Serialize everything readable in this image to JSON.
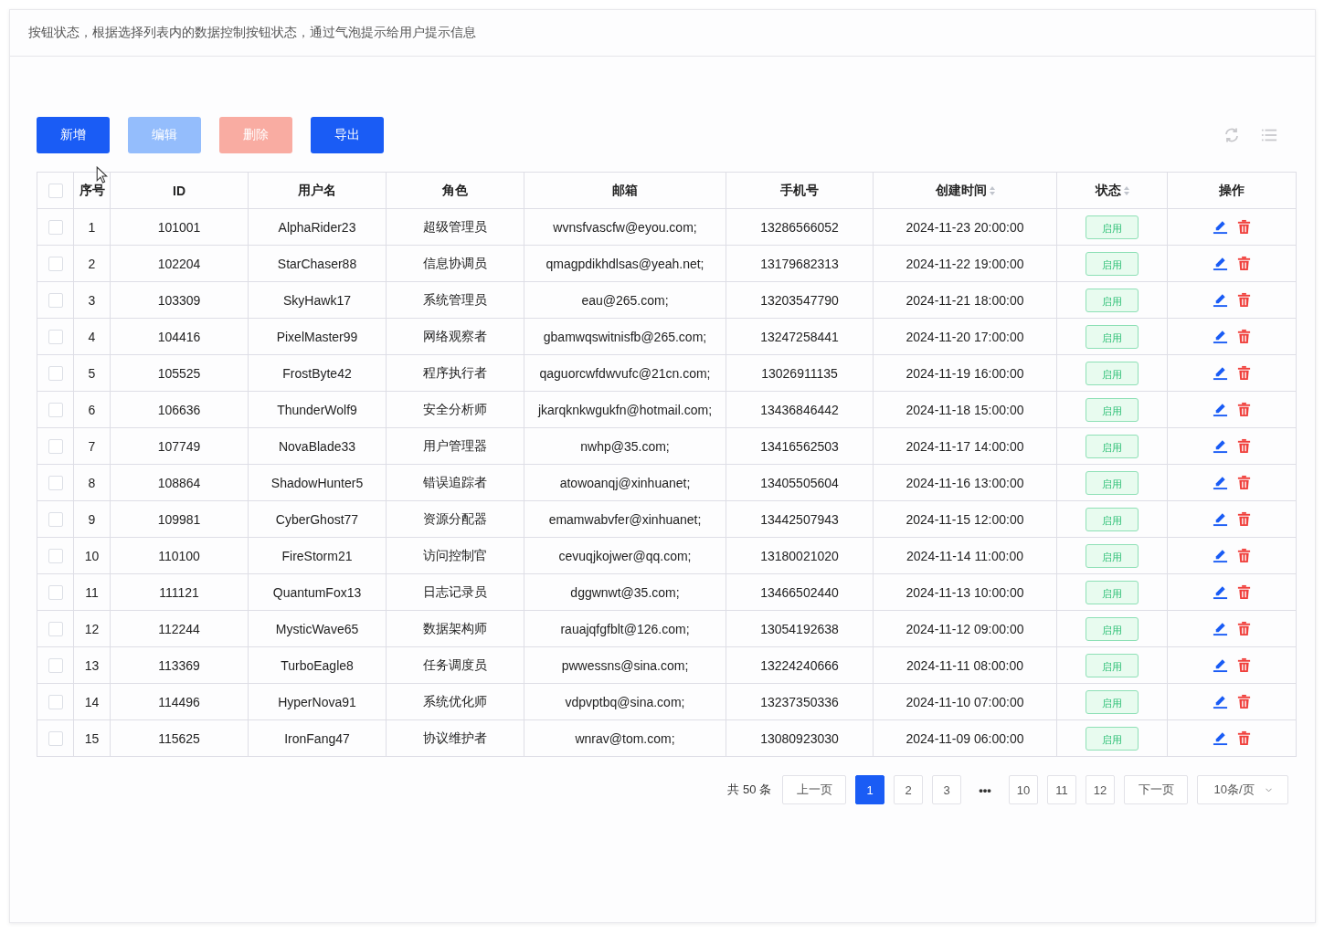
{
  "header": {
    "title": "按钮状态，根据选择列表内的数据控制按钮状态，通过气泡提示给用户提示信息"
  },
  "toolbar": {
    "buttons": [
      {
        "label": "新增",
        "kind": "primary",
        "disabled": false
      },
      {
        "label": "编辑",
        "kind": "primary",
        "disabled": true
      },
      {
        "label": "删除",
        "kind": "danger",
        "disabled": true
      },
      {
        "label": "导出",
        "kind": "primary",
        "disabled": false
      }
    ]
  },
  "table": {
    "columns": [
      {
        "label": "序号",
        "sortable": false
      },
      {
        "label": "ID",
        "sortable": false
      },
      {
        "label": "用户名",
        "sortable": false
      },
      {
        "label": "角色",
        "sortable": false
      },
      {
        "label": "邮箱",
        "sortable": false
      },
      {
        "label": "手机号",
        "sortable": false
      },
      {
        "label": "创建时间",
        "sortable": true
      },
      {
        "label": "状态",
        "sortable": true
      },
      {
        "label": "操作",
        "sortable": false
      }
    ],
    "all_checked": false,
    "rows": [
      {
        "checked": false,
        "index": "1",
        "id": "101001",
        "username": "AlphaRider23",
        "role": "超级管理员",
        "email": "wvnsfvascfw@eyou.com;",
        "phone": "13286566052",
        "created": "2024-11-23 20:00:00",
        "status": "启用"
      },
      {
        "checked": false,
        "index": "2",
        "id": "102204",
        "username": "StarChaser88",
        "role": "信息协调员",
        "email": "qmagpdikhdlsas@yeah.net;",
        "phone": "13179682313",
        "created": "2024-11-22 19:00:00",
        "status": "启用"
      },
      {
        "checked": false,
        "index": "3",
        "id": "103309",
        "username": "SkyHawk17",
        "role": "系统管理员",
        "email": "eau@265.com;",
        "phone": "13203547790",
        "created": "2024-11-21 18:00:00",
        "status": "启用"
      },
      {
        "checked": false,
        "index": "4",
        "id": "104416",
        "username": "PixelMaster99",
        "role": "网络观察者",
        "email": "gbamwqswitnisfb@265.com;",
        "phone": "13247258441",
        "created": "2024-11-20 17:00:00",
        "status": "启用"
      },
      {
        "checked": false,
        "index": "5",
        "id": "105525",
        "username": "FrostByte42",
        "role": "程序执行者",
        "email": "qaguorcwfdwvufc@21cn.com;",
        "phone": "13026911135",
        "created": "2024-11-19 16:00:00",
        "status": "启用"
      },
      {
        "checked": false,
        "index": "6",
        "id": "106636",
        "username": "ThunderWolf9",
        "role": "安全分析师",
        "email": "jkarqknkwgukfn@hotmail.com;",
        "phone": "13436846442",
        "created": "2024-11-18 15:00:00",
        "status": "启用"
      },
      {
        "checked": false,
        "index": "7",
        "id": "107749",
        "username": "NovaBlade33",
        "role": "用户管理器",
        "email": "nwhp@35.com;",
        "phone": "13416562503",
        "created": "2024-11-17 14:00:00",
        "status": "启用"
      },
      {
        "checked": false,
        "index": "8",
        "id": "108864",
        "username": "ShadowHunter5",
        "role": "错误追踪者",
        "email": "atowoanqj@xinhuanet;",
        "phone": "13405505604",
        "created": "2024-11-16 13:00:00",
        "status": "启用"
      },
      {
        "checked": false,
        "index": "9",
        "id": "109981",
        "username": "CyberGhost77",
        "role": "资源分配器",
        "email": "emamwabvfer@xinhuanet;",
        "phone": "13442507943",
        "created": "2024-11-15 12:00:00",
        "status": "启用"
      },
      {
        "checked": false,
        "index": "10",
        "id": "110100",
        "username": "FireStorm21",
        "role": "访问控制官",
        "email": "cevuqjkojwer@qq.com;",
        "phone": "13180021020",
        "created": "2024-11-14 11:00:00",
        "status": "启用"
      },
      {
        "checked": false,
        "index": "11",
        "id": "111121",
        "username": "QuantumFox13",
        "role": "日志记录员",
        "email": "dggwnwt@35.com;",
        "phone": "13466502440",
        "created": "2024-11-13 10:00:00",
        "status": "启用"
      },
      {
        "checked": false,
        "index": "12",
        "id": "112244",
        "username": "MysticWave65",
        "role": "数据架构师",
        "email": "rauajqfgfblt@126.com;",
        "phone": "13054192638",
        "created": "2024-11-12 09:00:00",
        "status": "启用"
      },
      {
        "checked": false,
        "index": "13",
        "id": "113369",
        "username": "TurboEagle8",
        "role": "任务调度员",
        "email": "pwwessns@sina.com;",
        "phone": "13224240666",
        "created": "2024-11-11 08:00:00",
        "status": "启用"
      },
      {
        "checked": false,
        "index": "14",
        "id": "114496",
        "username": "HyperNova91",
        "role": "系统优化师",
        "email": "vdpvptbq@sina.com;",
        "phone": "13237350336",
        "created": "2024-11-10 07:00:00",
        "status": "启用"
      },
      {
        "checked": false,
        "index": "15",
        "id": "115625",
        "username": "IronFang47",
        "role": "协议维护者",
        "email": "wnrav@tom.com;",
        "phone": "13080923030",
        "created": "2024-11-09 06:00:00",
        "status": "启用"
      }
    ]
  },
  "pagination": {
    "total": "共 50 条",
    "prev": "上一页",
    "next": "下一页",
    "page_size": "10条/页",
    "pages": [
      {
        "label": "1",
        "kind": "page",
        "selected": true
      },
      {
        "label": "2",
        "kind": "page",
        "selected": false
      },
      {
        "label": "3",
        "kind": "page",
        "selected": false
      },
      {
        "label": "•••",
        "kind": "ellipsis"
      },
      {
        "label": "10",
        "kind": "page",
        "selected": false
      },
      {
        "label": "11",
        "kind": "page",
        "selected": false
      },
      {
        "label": "12",
        "kind": "page",
        "selected": false
      }
    ]
  }
}
